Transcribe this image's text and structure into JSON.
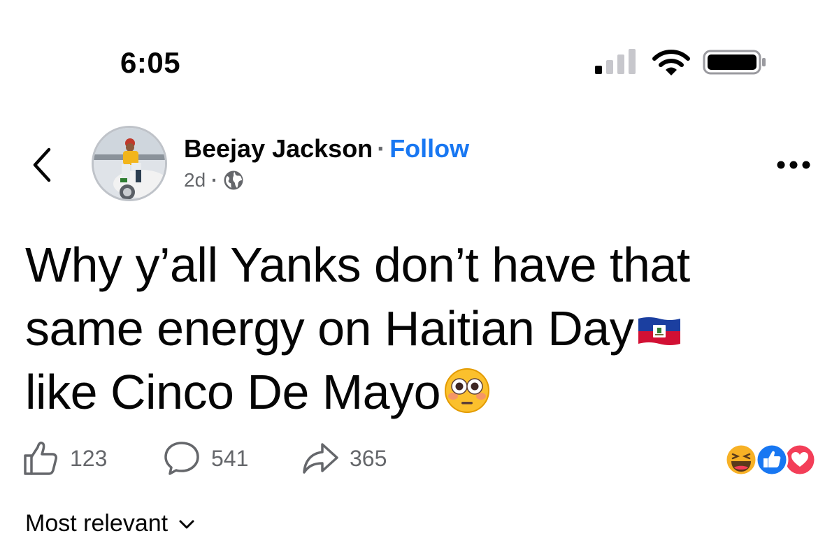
{
  "status_bar": {
    "time": "6:05",
    "icons": [
      "cellular-signal-icon",
      "wifi-icon",
      "battery-icon"
    ]
  },
  "post": {
    "author": "Beejay Jackson",
    "separator": "·",
    "follow_label": "Follow",
    "age": "2d",
    "meta_separator": "·",
    "audience_icon": "globe-icon",
    "text_lines": [
      "Why y’all Yanks don’t have that",
      "same energy on Haitian Day",
      "like Cinco De Mayo"
    ],
    "emojis": [
      "haiti-flag",
      "flushed-face"
    ]
  },
  "actions": {
    "likes": "123",
    "comments": "541",
    "shares": "365"
  },
  "reactions": [
    "haha",
    "like",
    "love"
  ],
  "comments_sort": {
    "label": "Most relevant"
  },
  "colors": {
    "accent": "#1877f2",
    "secondary_text": "#65676b",
    "love": "#f33e58",
    "haha": "#f7b125"
  }
}
